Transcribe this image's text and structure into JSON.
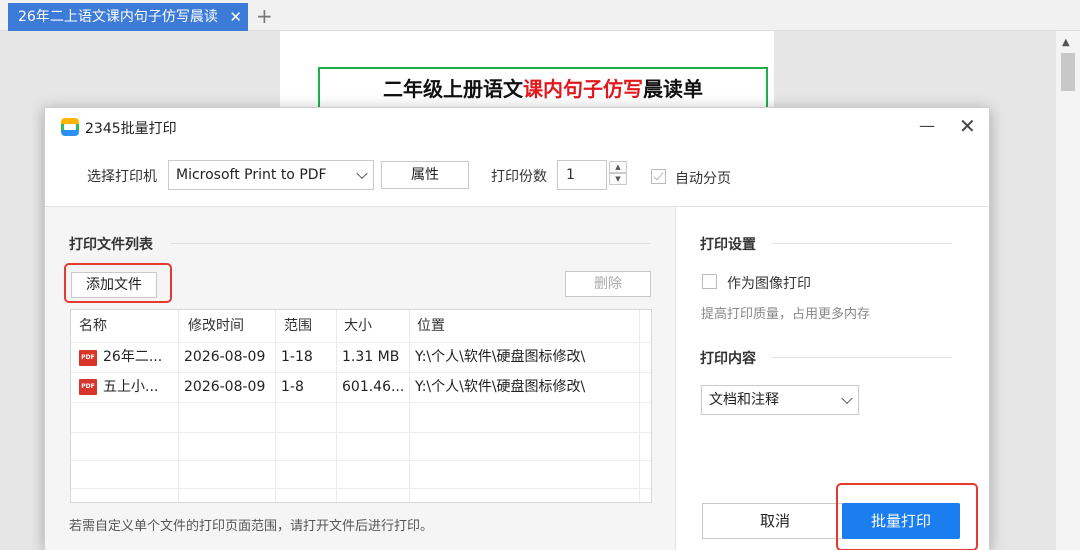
{
  "browser": {
    "tab_title": "26年二上语文课内句子仿写晨读",
    "tab_close": "✕",
    "new_tab": "+"
  },
  "document": {
    "title_part1": "二年级上册语文",
    "title_highlight": "课内句子仿写",
    "title_part2": "晨读单"
  },
  "dialog": {
    "title": "2345批量打印",
    "minimize": "—",
    "close": "✕",
    "printer_label": "选择打印机",
    "printer_value": "Microsoft Print to PDF",
    "properties_button": "属性",
    "copies_label": "打印份数",
    "copies_value": "1",
    "auto_paging_label": "自动分页",
    "auto_paging_checked": true,
    "file_list_title": "打印文件列表",
    "add_file_button": "添加文件",
    "delete_button": "删除",
    "columns": [
      "名称",
      "修改时间",
      "范围",
      "大小",
      "位置"
    ],
    "files": [
      {
        "name": "26年二...",
        "modified": "2026-08-09",
        "range": "1-18",
        "size": "1.31 MB",
        "location": "Y:\\个人\\软件\\硬盘图标修改\\"
      },
      {
        "name": "五上小...",
        "modified": "2026-08-09",
        "range": "1-8",
        "size": "601.46...",
        "location": "Y:\\个人\\软件\\硬盘图标修改\\"
      }
    ],
    "file_icon_text": "PDF",
    "hint": "若需自定义单个文件的打印页面范围，请打开文件后进行打印。",
    "print_settings_title": "打印设置",
    "as_image_label": "作为图像打印",
    "as_image_checked": false,
    "as_image_hint": "提高打印质量，占用更多内存",
    "print_content_title": "打印内容",
    "print_content_value": "文档和注释",
    "cancel_button": "取消",
    "batch_print_button": "批量打印"
  },
  "colors": {
    "tab_active": "#3d7bd9",
    "primary_button": "#1a7df0",
    "highlight_box": "#e53a2e",
    "doc_title_border": "#1fae4f",
    "doc_title_highlight": "#e0191f"
  }
}
